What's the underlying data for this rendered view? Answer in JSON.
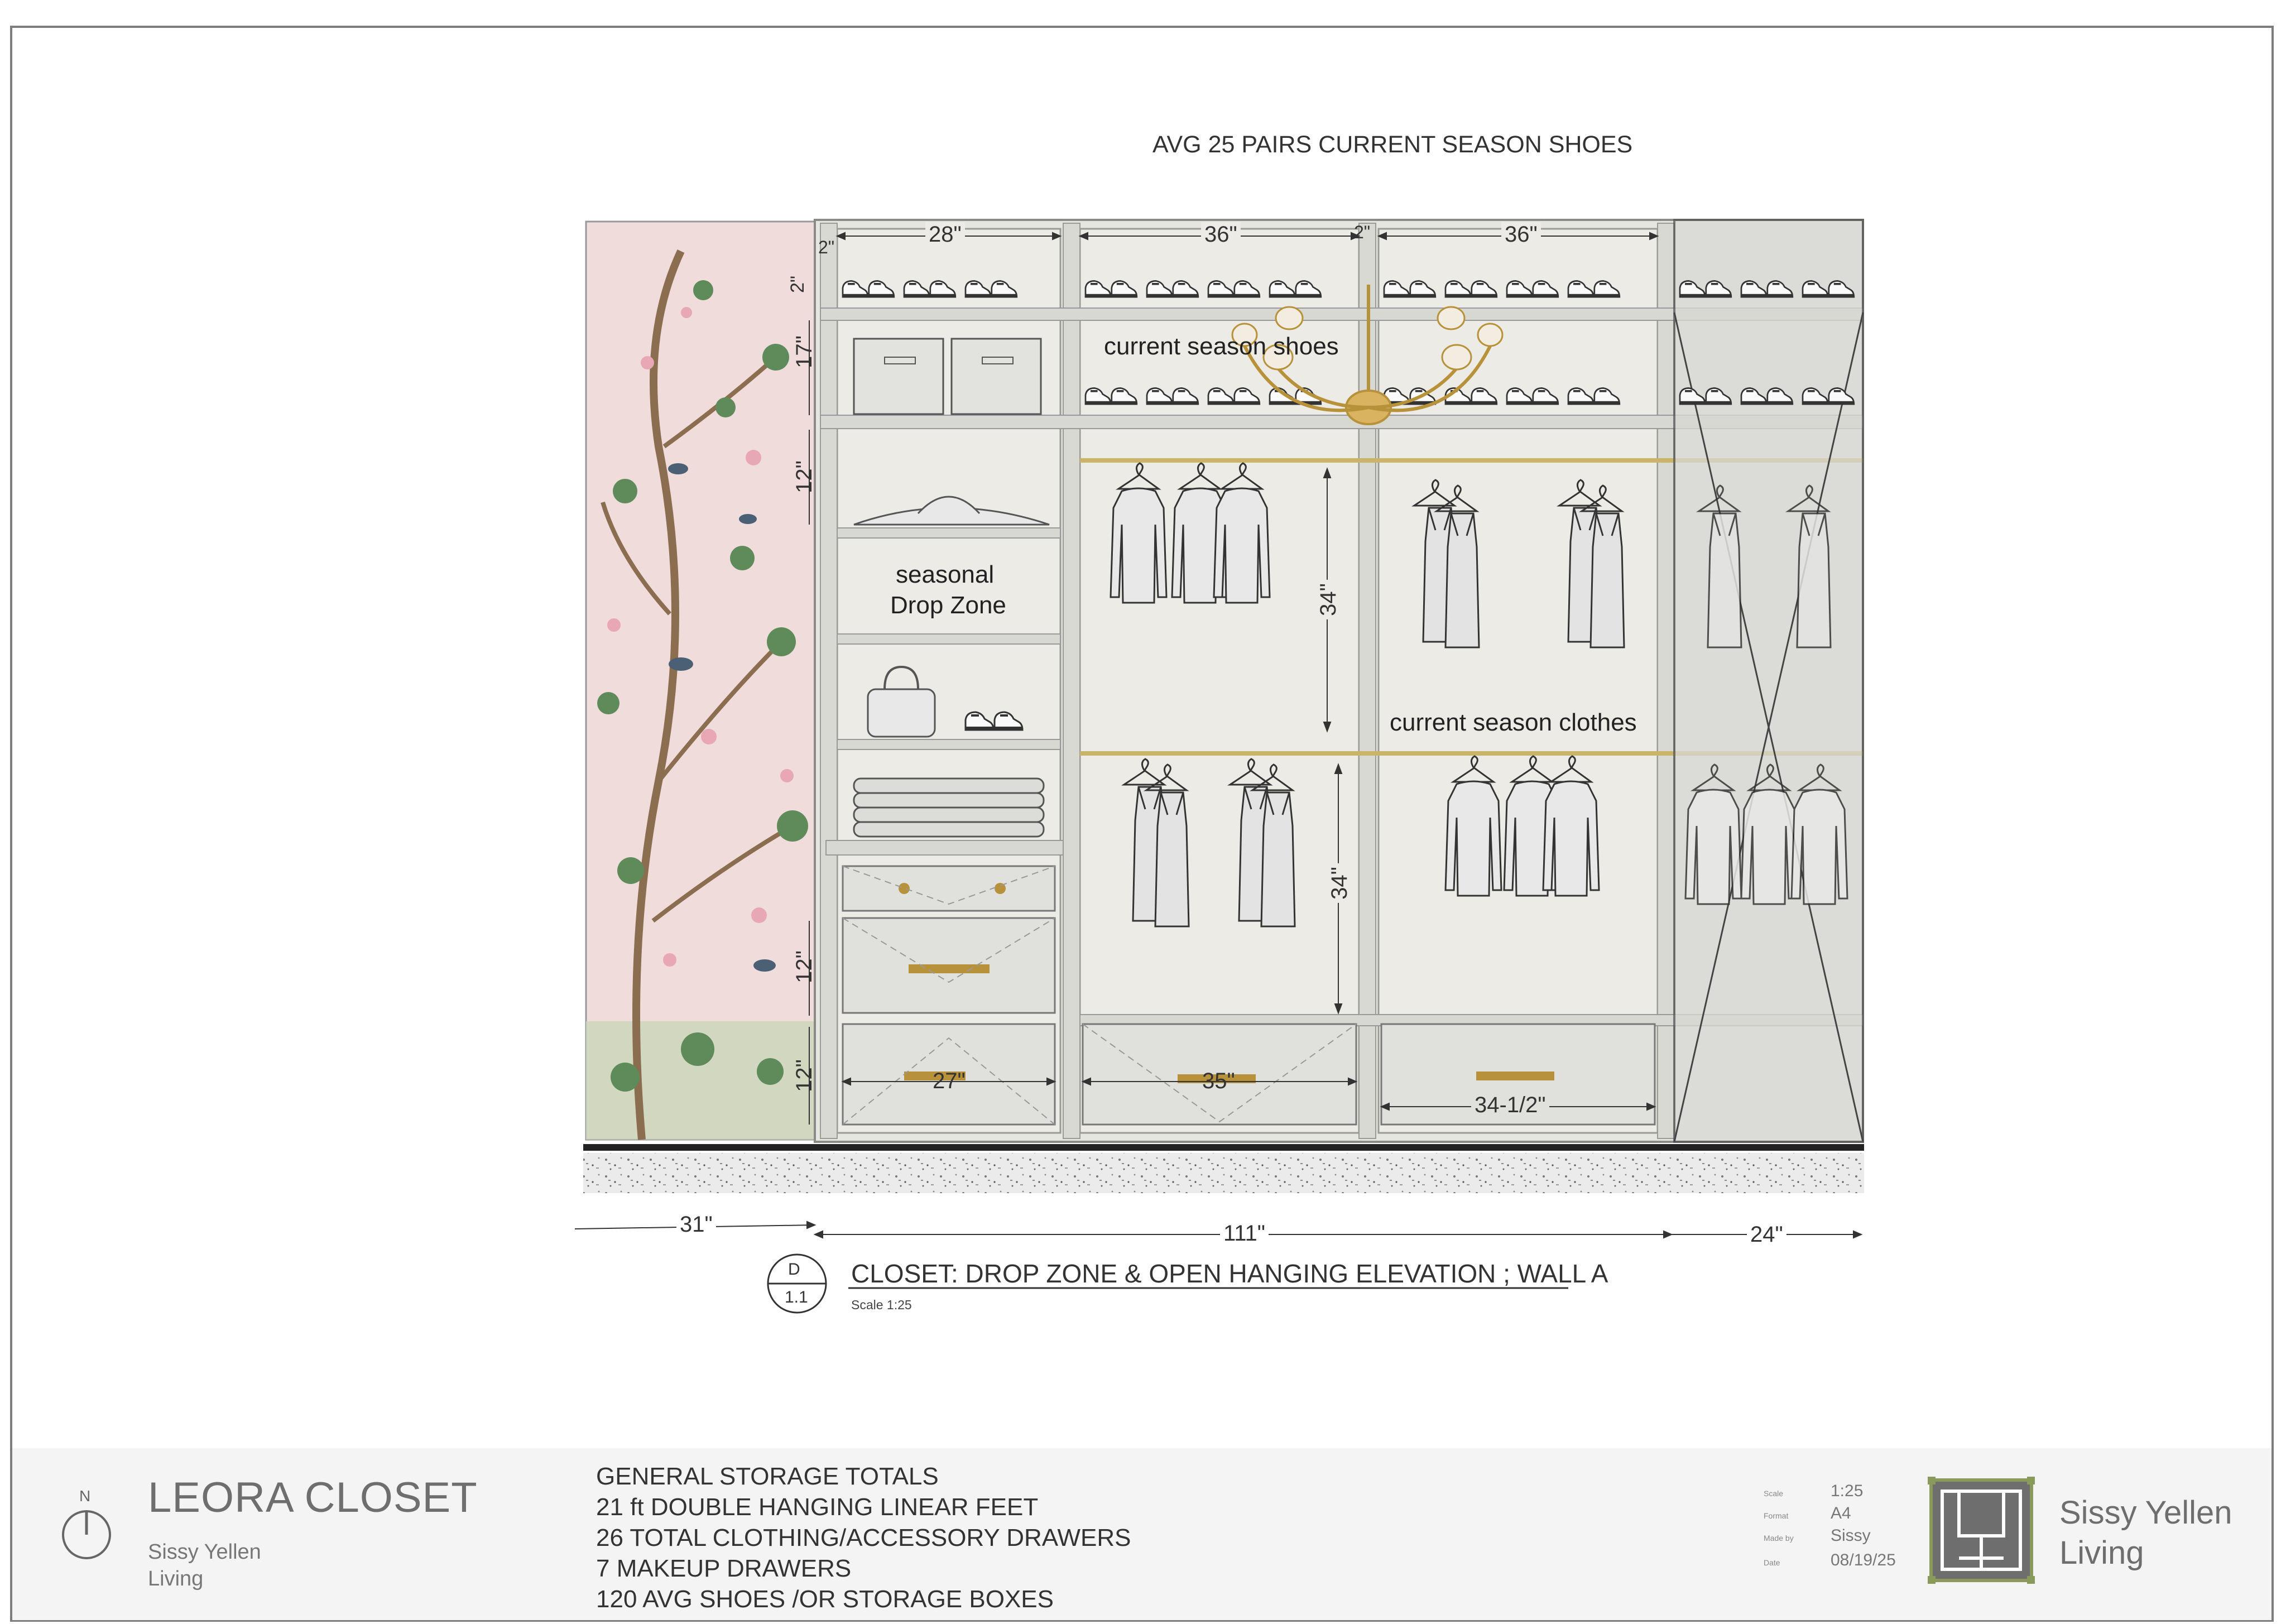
{
  "header_note": "AVG 25 PAIRS CURRENT SEASON SHOES",
  "labels": {
    "current_season_shoes": "current season shoes",
    "seasonal_line1": "seasonal",
    "seasonal_line2": "Drop Zone",
    "current_season_clothes": "current season clothes"
  },
  "dimensions": {
    "top_2a": "2\"",
    "top_28": "28\"",
    "top_36a": "36\"",
    "top_2b": "2\"",
    "top_36b": "36\"",
    "left_2": "2\"",
    "left_17": "17\"",
    "left_12a": "12\"",
    "left_12b": "12\"",
    "left_12c": "12\"",
    "hang_34a": "34\"",
    "hang_34b": "34\"",
    "drawer_27": "27\"",
    "drawer_35": "35\"",
    "drawer_34_5": "34-1/2\"",
    "bottom_31": "31\"",
    "bottom_111": "111\"",
    "bottom_24": "24\""
  },
  "section_marker": {
    "top": "D",
    "bottom": "1.1",
    "title": "CLOSET: DROP ZONE & OPEN HANGING ELEVATION ; WALL A",
    "scale": "Scale 1:25"
  },
  "title_block": {
    "north": "N",
    "project": "LEORA CLOSET",
    "company_line1": "Sissy Yellen",
    "company_line2": "Living",
    "totals": [
      "GENERAL STORAGE TOTALS",
      "21 ft DOUBLE HANGING LINEAR FEET",
      "26 TOTAL CLOTHING/ACCESSORY DRAWERS",
      "7 MAKEUP DRAWERS",
      "120 AVG SHOES /OR STORAGE  BOXES"
    ],
    "meta": {
      "scale_label": "Scale",
      "scale_value": "1:25",
      "format_label": "Format",
      "format_value": "A4",
      "made_by_label": "Made by",
      "made_by_value": "Sissy",
      "date_label": "Date",
      "date_value": "08/19/25"
    },
    "brand_line1": "Sissy Yellen",
    "brand_line2": "Living"
  },
  "colors": {
    "wallpaper": "#f1dcdc",
    "cabinet": "#e6e6e1",
    "cabinet_stroke": "#9a9a96",
    "brass": "#b8923a",
    "floor": "#e4e4e4",
    "title_bg": "#f4f4f4"
  }
}
